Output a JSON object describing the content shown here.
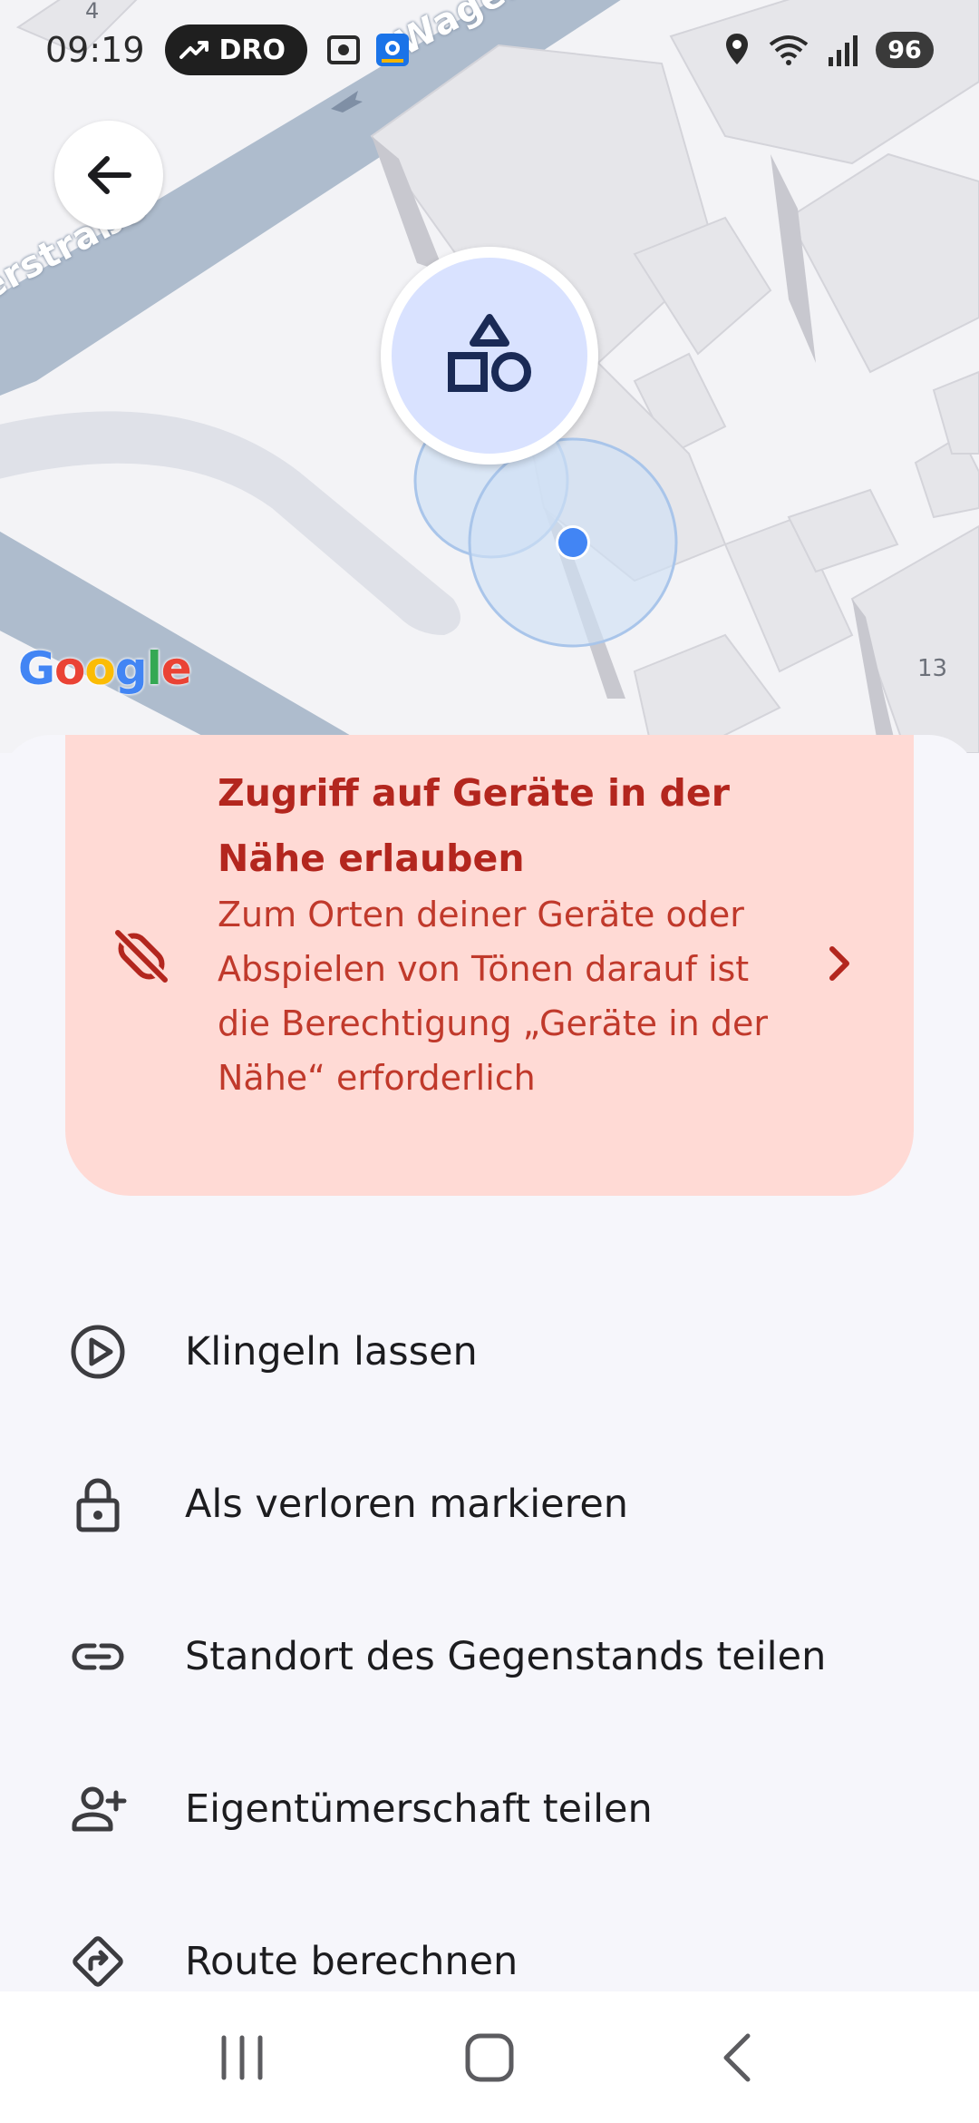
{
  "status_bar": {
    "time": "09:19",
    "pill_label": "DRO",
    "battery": "96"
  },
  "map": {
    "street_label_left": "erstraße",
    "street_label_top": "Wagene",
    "number_13": "13",
    "number_4": "4",
    "google_logo": [
      "G",
      "o",
      "o",
      "g",
      "l",
      "e"
    ]
  },
  "permission_card": {
    "title": "Zugriff auf Geräte in der Nähe erlauben",
    "body": "Zum Orten deiner Geräte oder Abspielen von Tönen darauf ist die Berechtigung „Geräte in der Nähe“ erforderlich",
    "icon": "link-off-icon"
  },
  "actions": [
    {
      "label": "Klingeln lassen",
      "icon": "play-circle-icon"
    },
    {
      "label": "Als verloren markieren",
      "icon": "lock-icon"
    },
    {
      "label": "Standort des Gegenstands teilen",
      "icon": "link-icon"
    },
    {
      "label": "Eigentümerschaft teilen",
      "icon": "person-add-icon"
    },
    {
      "label": "Route berechnen",
      "icon": "directions-icon"
    }
  ],
  "colors": {
    "card_bg": "#ffdad5",
    "card_text": "#b3261e",
    "marker_bg": "#d9e2ff",
    "location_dot": "#4285f4"
  }
}
